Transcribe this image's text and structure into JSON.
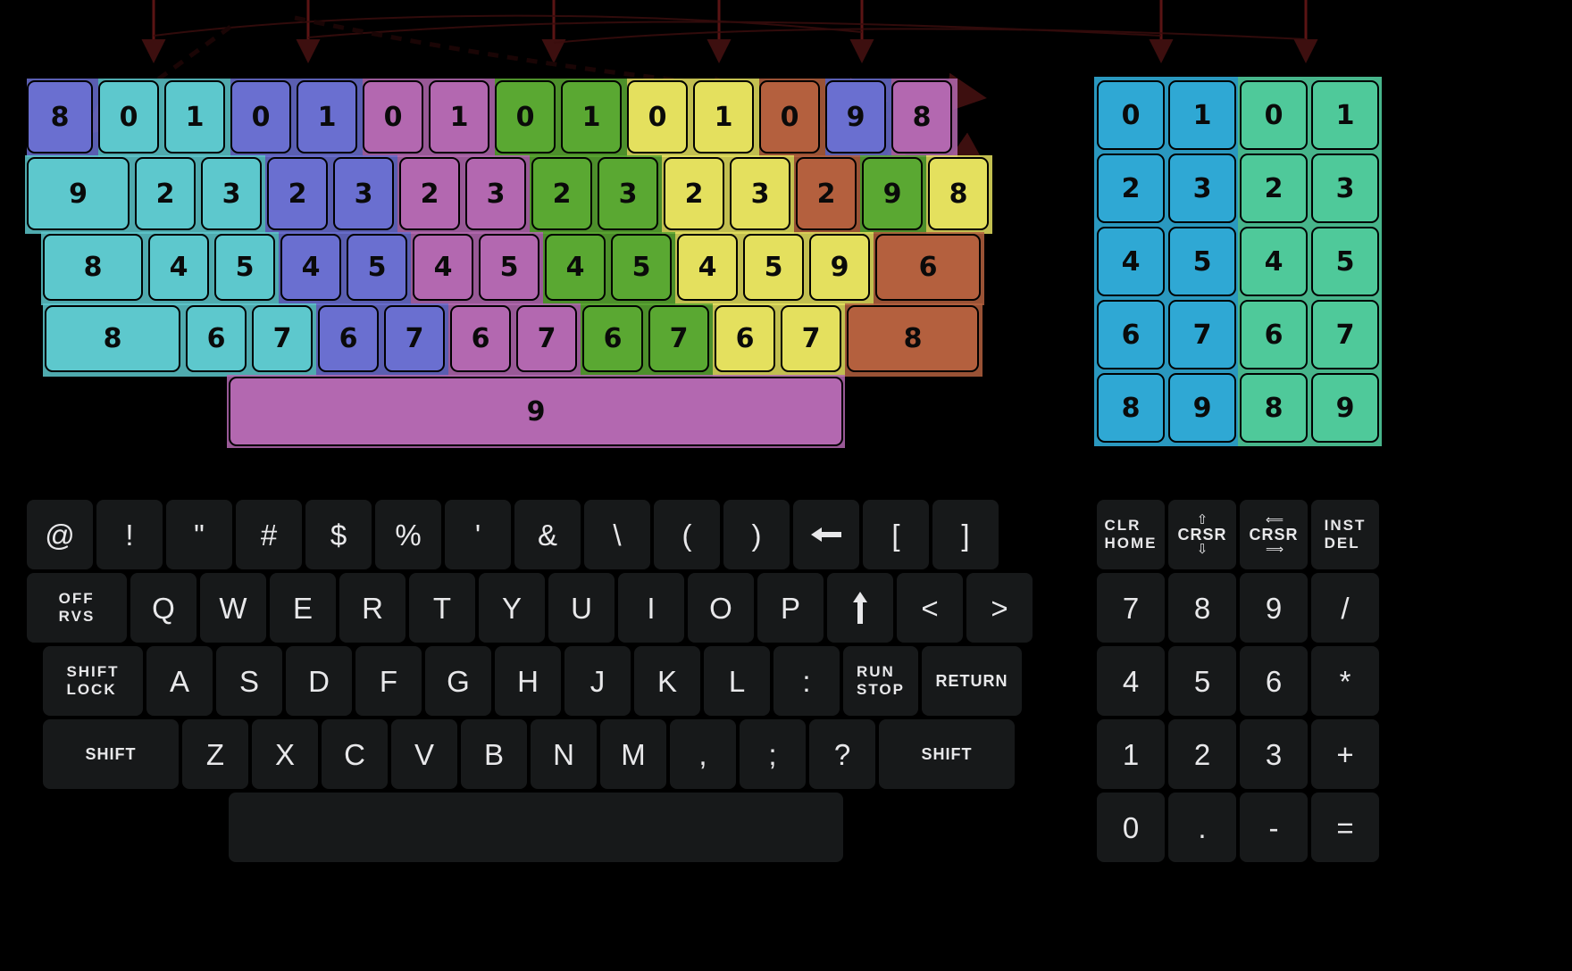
{
  "palette": {
    "cyan": "#5dc8cd",
    "blue": "#6a6fd0",
    "purple": "#b368b0",
    "green": "#5aa832",
    "yellow": "#e4e05e",
    "brown": "#b4603e",
    "keypad_blue": "#2fa8d4",
    "keypad_green": "#4fc99a",
    "key_face": "#17191a",
    "key_text": "#e8e8ea",
    "arrow": "#4a1212",
    "background": "#000000"
  },
  "overlay": {
    "title": "key-matrix-color-map",
    "main_rows": [
      {
        "name": "overlay-row-1",
        "keys": [
          {
            "label": "8",
            "color": "blue"
          },
          {
            "label": "0",
            "color": "cyan"
          },
          {
            "label": "1",
            "color": "cyan"
          },
          {
            "label": "0",
            "color": "blue"
          },
          {
            "label": "1",
            "color": "blue"
          },
          {
            "label": "0",
            "color": "purple"
          },
          {
            "label": "1",
            "color": "purple"
          },
          {
            "label": "0",
            "color": "green"
          },
          {
            "label": "1",
            "color": "green"
          },
          {
            "label": "0",
            "color": "yellow"
          },
          {
            "label": "1",
            "color": "yellow"
          },
          {
            "label": "0",
            "color": "brown"
          },
          {
            "label": "9",
            "color": "blue"
          },
          {
            "label": "8",
            "color": "purple"
          }
        ]
      },
      {
        "name": "overlay-row-2",
        "keys": [
          {
            "label": "9",
            "color": "cyan"
          },
          {
            "label": "2",
            "color": "cyan"
          },
          {
            "label": "3",
            "color": "cyan"
          },
          {
            "label": "2",
            "color": "blue"
          },
          {
            "label": "3",
            "color": "blue"
          },
          {
            "label": "2",
            "color": "purple"
          },
          {
            "label": "3",
            "color": "purple"
          },
          {
            "label": "2",
            "color": "green"
          },
          {
            "label": "3",
            "color": "green"
          },
          {
            "label": "2",
            "color": "yellow"
          },
          {
            "label": "3",
            "color": "yellow"
          },
          {
            "label": "2",
            "color": "brown"
          },
          {
            "label": "9",
            "color": "green"
          },
          {
            "label": "8",
            "color": "yellow"
          }
        ]
      },
      {
        "name": "overlay-row-3",
        "keys": [
          {
            "label": "8",
            "color": "cyan"
          },
          {
            "label": "4",
            "color": "cyan"
          },
          {
            "label": "5",
            "color": "cyan"
          },
          {
            "label": "4",
            "color": "blue"
          },
          {
            "label": "5",
            "color": "blue"
          },
          {
            "label": "4",
            "color": "purple"
          },
          {
            "label": "5",
            "color": "purple"
          },
          {
            "label": "4",
            "color": "green"
          },
          {
            "label": "5",
            "color": "green"
          },
          {
            "label": "4",
            "color": "yellow"
          },
          {
            "label": "5",
            "color": "yellow"
          },
          {
            "label": "9",
            "color": "yellow"
          },
          {
            "label": "6",
            "color": "brown"
          }
        ]
      },
      {
        "name": "overlay-row-4",
        "keys": [
          {
            "label": "8",
            "color": "cyan"
          },
          {
            "label": "6",
            "color": "cyan"
          },
          {
            "label": "7",
            "color": "cyan"
          },
          {
            "label": "6",
            "color": "blue"
          },
          {
            "label": "7",
            "color": "blue"
          },
          {
            "label": "6",
            "color": "purple"
          },
          {
            "label": "7",
            "color": "purple"
          },
          {
            "label": "6",
            "color": "green"
          },
          {
            "label": "7",
            "color": "green"
          },
          {
            "label": "6",
            "color": "yellow"
          },
          {
            "label": "7",
            "color": "yellow"
          },
          {
            "label": "8",
            "color": "brown"
          }
        ]
      },
      {
        "name": "overlay-row-5-space",
        "keys": [
          {
            "label": "9",
            "color": "purple"
          }
        ]
      }
    ],
    "keypad_rows": [
      {
        "name": "overlay-keypad-row-1",
        "keys": [
          {
            "label": "0",
            "color": "keypad_blue"
          },
          {
            "label": "1",
            "color": "keypad_blue"
          },
          {
            "label": "0",
            "color": "keypad_green"
          },
          {
            "label": "1",
            "color": "keypad_green"
          }
        ]
      },
      {
        "name": "overlay-keypad-row-2",
        "keys": [
          {
            "label": "2",
            "color": "keypad_blue"
          },
          {
            "label": "3",
            "color": "keypad_blue"
          },
          {
            "label": "2",
            "color": "keypad_green"
          },
          {
            "label": "3",
            "color": "keypad_green"
          }
        ]
      },
      {
        "name": "overlay-keypad-row-3",
        "keys": [
          {
            "label": "4",
            "color": "keypad_blue"
          },
          {
            "label": "5",
            "color": "keypad_blue"
          },
          {
            "label": "4",
            "color": "keypad_green"
          },
          {
            "label": "5",
            "color": "keypad_green"
          }
        ]
      },
      {
        "name": "overlay-keypad-row-4",
        "keys": [
          {
            "label": "6",
            "color": "keypad_blue"
          },
          {
            "label": "7",
            "color": "keypad_blue"
          },
          {
            "label": "6",
            "color": "keypad_green"
          },
          {
            "label": "7",
            "color": "keypad_green"
          }
        ]
      },
      {
        "name": "overlay-keypad-row-5",
        "keys": [
          {
            "label": "8",
            "color": "keypad_blue"
          },
          {
            "label": "9",
            "color": "keypad_blue"
          },
          {
            "label": "8",
            "color": "keypad_green"
          },
          {
            "label": "9",
            "color": "keypad_green"
          }
        ]
      }
    ]
  },
  "keyboard": {
    "main_rows": [
      {
        "name": "kb-row-symbols",
        "keys": [
          {
            "label": "@",
            "icon": "at-sign"
          },
          {
            "label": "!",
            "icon": "exclamation"
          },
          {
            "label": "\"",
            "icon": "double-quote"
          },
          {
            "label": "#",
            "icon": "hash"
          },
          {
            "label": "$",
            "icon": "dollar"
          },
          {
            "label": "%",
            "icon": "percent"
          },
          {
            "label": "'",
            "icon": "apostrophe"
          },
          {
            "label": "&",
            "icon": "ampersand"
          },
          {
            "label": "\\",
            "icon": "backslash"
          },
          {
            "label": "(",
            "icon": "paren-open"
          },
          {
            "label": ")",
            "icon": "paren-close"
          },
          {
            "label": "←",
            "icon": "left-arrow"
          },
          {
            "label": "[",
            "icon": "bracket-open"
          },
          {
            "label": "]",
            "icon": "bracket-close"
          }
        ]
      },
      {
        "name": "kb-row-qwerty",
        "keys": [
          {
            "label": "OFF\nRVS",
            "icon": "off-rvs",
            "multiline": true
          },
          {
            "label": "Q"
          },
          {
            "label": "W"
          },
          {
            "label": "E"
          },
          {
            "label": "R"
          },
          {
            "label": "T"
          },
          {
            "label": "Y"
          },
          {
            "label": "U"
          },
          {
            "label": "I"
          },
          {
            "label": "O"
          },
          {
            "label": "P"
          },
          {
            "label": "↑",
            "icon": "up-arrow"
          },
          {
            "label": "<",
            "icon": "less-than"
          },
          {
            "label": ">",
            "icon": "greater-than"
          }
        ]
      },
      {
        "name": "kb-row-asdf",
        "keys": [
          {
            "label": "SHIFT\nLOCK",
            "icon": "shift-lock",
            "multiline": true
          },
          {
            "label": "A"
          },
          {
            "label": "S"
          },
          {
            "label": "D"
          },
          {
            "label": "F"
          },
          {
            "label": "G"
          },
          {
            "label": "H"
          },
          {
            "label": "J"
          },
          {
            "label": "K"
          },
          {
            "label": "L"
          },
          {
            "label": ":",
            "icon": "colon"
          },
          {
            "label": "RUN\nSTOP",
            "icon": "run-stop",
            "multiline": true
          },
          {
            "label": "RETURN",
            "icon": "return-key"
          }
        ]
      },
      {
        "name": "kb-row-zxcv",
        "keys": [
          {
            "label": "SHIFT",
            "icon": "shift-left"
          },
          {
            "label": "Z"
          },
          {
            "label": "X"
          },
          {
            "label": "C"
          },
          {
            "label": "V"
          },
          {
            "label": "B"
          },
          {
            "label": "N"
          },
          {
            "label": "M"
          },
          {
            "label": ",",
            "icon": "comma"
          },
          {
            "label": ";",
            "icon": "semicolon"
          },
          {
            "label": "?",
            "icon": "question-mark"
          },
          {
            "label": "SHIFT",
            "icon": "shift-right"
          }
        ]
      },
      {
        "name": "kb-row-space",
        "keys": [
          {
            "label": "",
            "icon": "space-bar"
          }
        ]
      }
    ],
    "keypad_rows": [
      {
        "name": "keypad-row-1",
        "keys": [
          {
            "label": "CLR\nHOME",
            "icon": "clr-home",
            "multiline": true
          },
          {
            "label": "CRSR",
            "icon": "crsr-vertical"
          },
          {
            "label": "CRSR",
            "icon": "crsr-horizontal"
          },
          {
            "label": "INST\nDEL",
            "icon": "inst-del",
            "multiline": true
          }
        ]
      },
      {
        "name": "keypad-row-2",
        "keys": [
          {
            "label": "7"
          },
          {
            "label": "8"
          },
          {
            "label": "9"
          },
          {
            "label": "/",
            "icon": "divide"
          }
        ]
      },
      {
        "name": "keypad-row-3",
        "keys": [
          {
            "label": "4"
          },
          {
            "label": "5"
          },
          {
            "label": "6"
          },
          {
            "label": "*",
            "icon": "multiply"
          }
        ]
      },
      {
        "name": "keypad-row-4",
        "keys": [
          {
            "label": "1"
          },
          {
            "label": "2"
          },
          {
            "label": "3"
          },
          {
            "label": "+",
            "icon": "plus"
          }
        ]
      },
      {
        "name": "keypad-row-5",
        "keys": [
          {
            "label": "0"
          },
          {
            "label": ".",
            "icon": "period"
          },
          {
            "label": "-",
            "icon": "minus"
          },
          {
            "label": "=",
            "icon": "equals"
          }
        ]
      }
    ]
  },
  "annotations": {
    "arrow_count": 6,
    "description": "dashed arrows pointing from top edge down into overlay keys"
  }
}
